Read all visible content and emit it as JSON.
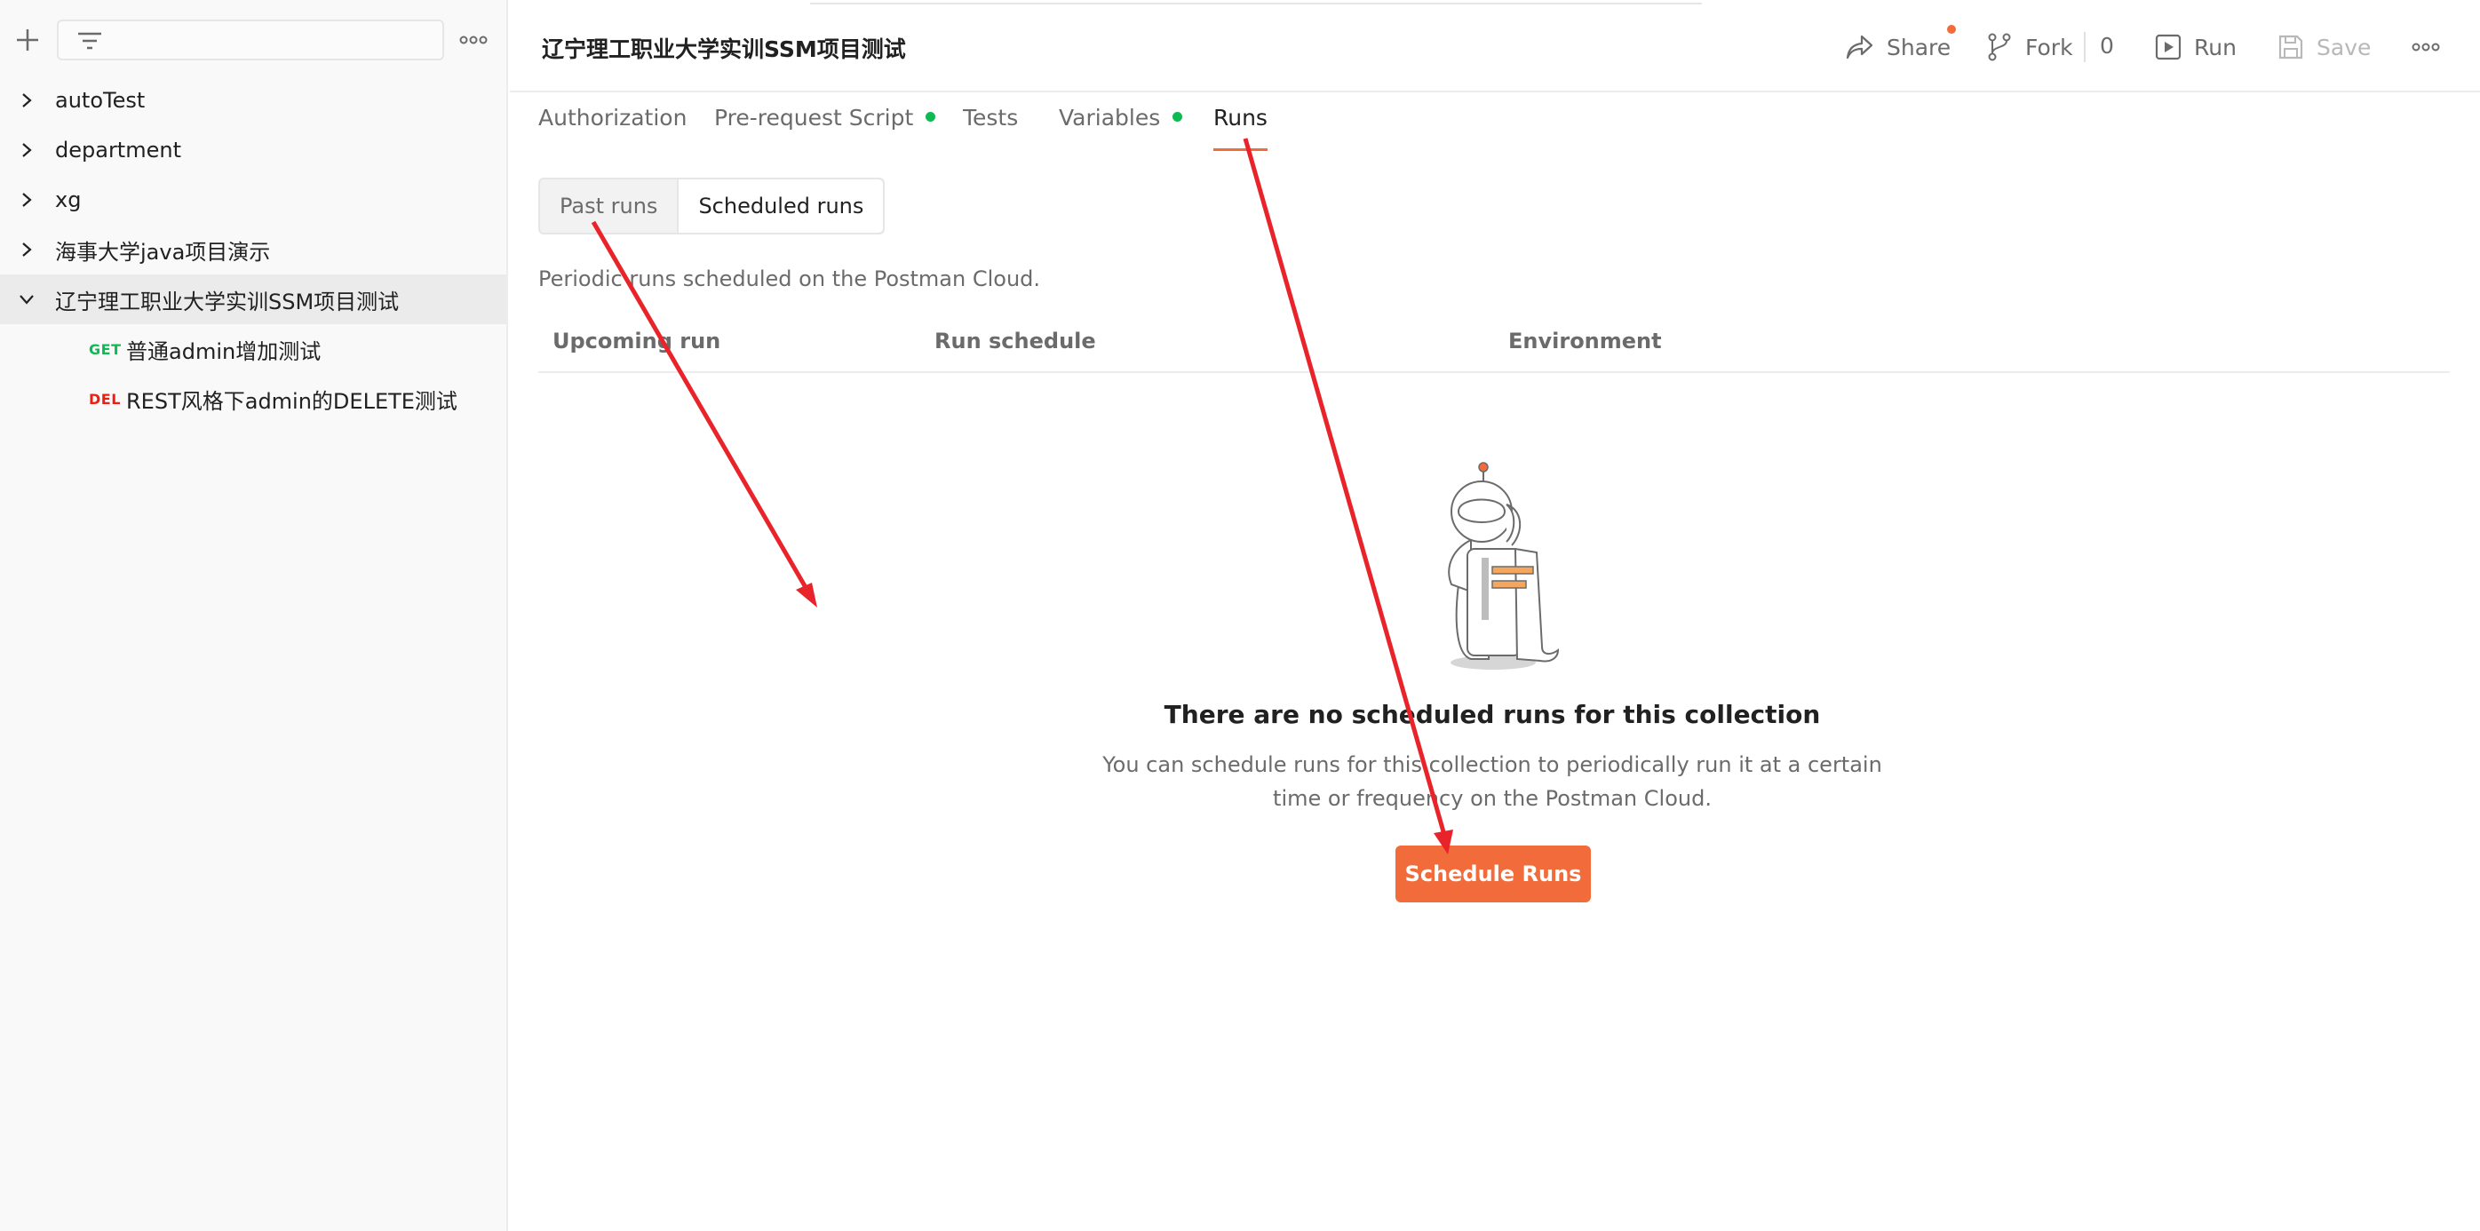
{
  "sidebar": {
    "filter_placeholder": "",
    "collections": [
      {
        "label": "autoTest",
        "expanded": false
      },
      {
        "label": "department",
        "expanded": false
      },
      {
        "label": "xg",
        "expanded": false
      },
      {
        "label": "海事大学java项目演示",
        "expanded": false
      },
      {
        "label": "辽宁理工职业大学实训SSM项目测试",
        "expanded": true
      }
    ],
    "requests": [
      {
        "method": "GET",
        "label": "普通admin增加测试"
      },
      {
        "method": "DEL",
        "label": "REST风格下admin的DELETE测试"
      }
    ]
  },
  "header": {
    "title": "辽宁理工职业大学实训SSM项目测试",
    "share_label": "Share",
    "fork_label": "Fork",
    "fork_count": "0",
    "run_label": "Run",
    "save_label": "Save"
  },
  "tabs": [
    {
      "label": "Authorization",
      "dot": false
    },
    {
      "label": "Pre-request Script",
      "dot": true
    },
    {
      "label": "Tests",
      "dot": false
    },
    {
      "label": "Variables",
      "dot": true
    },
    {
      "label": "Runs",
      "dot": false,
      "active": true
    }
  ],
  "runs": {
    "segments": [
      "Past runs",
      "Scheduled runs"
    ],
    "active_segment": "Scheduled runs",
    "description": "Periodic runs scheduled on the Postman Cloud.",
    "columns": [
      "Upcoming run",
      "Run schedule",
      "Environment"
    ],
    "empty_title": "There are no scheduled runs for this collection",
    "empty_text": "You can schedule runs for this collection to periodically run it at a certain time or frequency on the Postman Cloud.",
    "cta_label": "Schedule Runs"
  },
  "colors": {
    "accent": "#f26b3a",
    "green_dot": "#0cbb52",
    "get": "#0cbb52",
    "del": "#eb2013",
    "annotation_arrow": "#e8232a"
  }
}
